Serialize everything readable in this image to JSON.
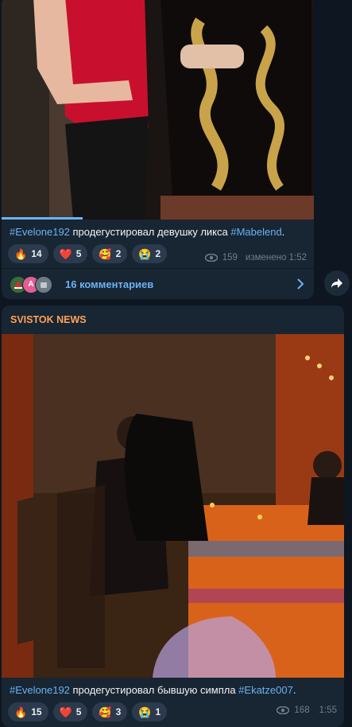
{
  "posts": [
    {
      "caption_tag1": "#Evelone192",
      "caption_mid": " продегустировал девушку ликса ",
      "caption_tag2": "#Mabelend",
      "caption_end": ".",
      "reactions": [
        {
          "emoji": "🔥",
          "count": "14"
        },
        {
          "emoji": "❤️",
          "count": "5"
        },
        {
          "emoji": "🥰",
          "count": "2"
        },
        {
          "emoji": "😭",
          "count": "2"
        }
      ],
      "views": "159",
      "edited_time": "изменено 1:52",
      "comments_label": "16 комментариев",
      "avatar_letter": "A",
      "progress": 0.26
    },
    {
      "channel": "SVISTOK NEWS",
      "caption_tag1": "#Evelone192",
      "caption_mid": " продегустировал бывшую симпла ",
      "caption_tag2": "#Ekatze007",
      "caption_end": ".",
      "reactions": [
        {
          "emoji": "🔥",
          "count": "15"
        },
        {
          "emoji": "❤️",
          "count": "5"
        },
        {
          "emoji": "🥰",
          "count": "3"
        },
        {
          "emoji": "😭",
          "count": "1"
        }
      ],
      "views": "168",
      "time": "1:55"
    }
  ],
  "colors": {
    "link": "#6ab3f3",
    "channel": "#ffa257",
    "bubble": "#182533",
    "background": "#0e1621"
  }
}
